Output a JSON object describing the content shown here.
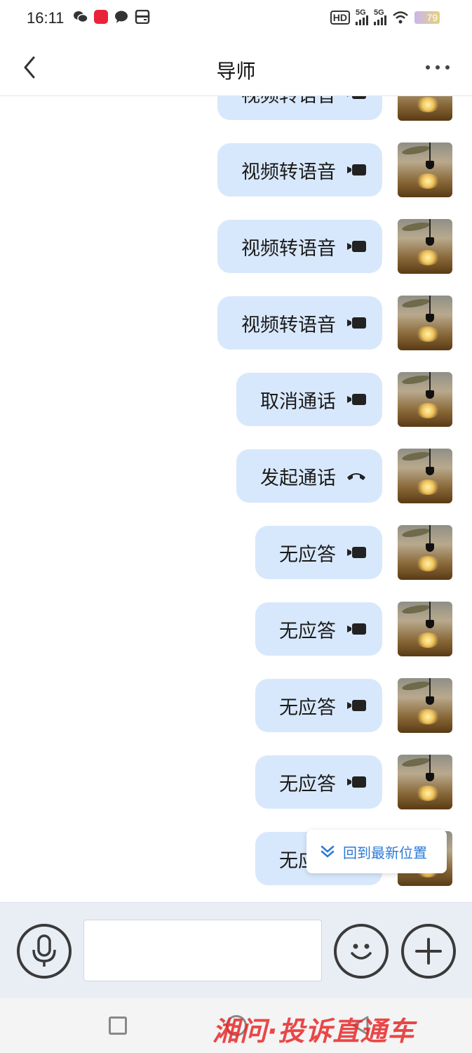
{
  "status_bar": {
    "time": "16:11",
    "hd_label": "HD",
    "network_1": "5G",
    "network_2": "5G",
    "battery": "79"
  },
  "header": {
    "title": "导师",
    "back_icon": "chevron-left-icon",
    "more_icon": "more-dots-icon"
  },
  "messages": [
    {
      "text": "视频转语音",
      "icon": "video-icon"
    },
    {
      "text": "视频转语音",
      "icon": "video-icon"
    },
    {
      "text": "视频转语音",
      "icon": "video-icon"
    },
    {
      "text": "视频转语音",
      "icon": "video-icon"
    },
    {
      "text": "取消通话",
      "icon": "video-icon"
    },
    {
      "text": "发起通话",
      "icon": "phone-hangup-icon"
    },
    {
      "text": "无应答",
      "icon": "video-icon"
    },
    {
      "text": "无应答",
      "icon": "video-icon"
    },
    {
      "text": "无应答",
      "icon": "video-icon"
    },
    {
      "text": "无应答",
      "icon": "video-icon"
    },
    {
      "text": "无应答",
      "icon": "video-icon"
    }
  ],
  "jump_to_latest": "回到最新位置",
  "input_bar": {
    "voice_icon": "microphone-icon",
    "emoji_icon": "smiley-icon",
    "plus_icon": "plus-icon"
  },
  "watermark": "湘问·投诉直通车",
  "colors": {
    "bubble": "#d8e8fc",
    "accent": "#2a7ad8",
    "input_bar_bg": "#e9eef5"
  }
}
